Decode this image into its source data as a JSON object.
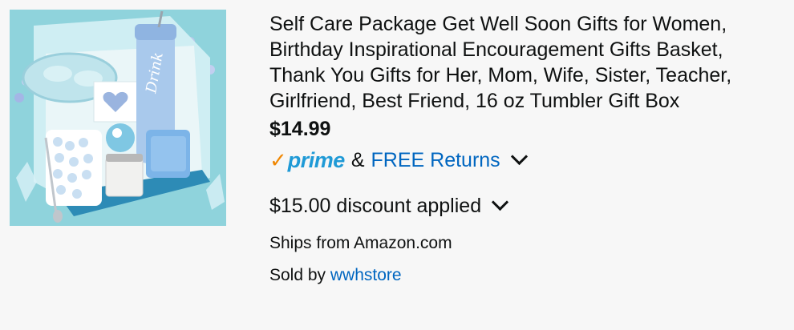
{
  "product": {
    "title_lines": [
      "Self Care Package Get Well Soon Gifts for Women,",
      "Birthday Inspirational Encouragement Gifts Basket,",
      "Thank You Gifts for Her, Mom, Wife, Sister, Teacher,",
      "Girlfriend, Best Friend, 16 oz Tumbler Gift Box"
    ],
    "price": "$14.99",
    "prime_check": "✓",
    "prime_label": "prime",
    "amp": "&",
    "free_returns": "FREE Returns",
    "discount": "$15.00 discount applied",
    "ships_from": "Ships from Amazon.com",
    "sold_by_prefix": "Sold by",
    "seller": "wwhstore",
    "image_tumbler_text": "Drink"
  },
  "colors": {
    "prime_check": "#f08804",
    "prime_word": "#1f9ad6",
    "link": "#0066c0",
    "background": "#f7f7f7"
  },
  "icons": {
    "chevron": "chevron-down-icon"
  }
}
